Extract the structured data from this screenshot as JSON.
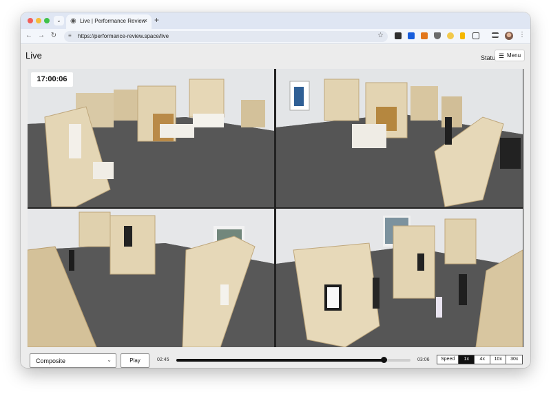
{
  "browser": {
    "tab_title": "Live | Performance Review",
    "tab_favicon": "globe-icon",
    "new_tab_symbol": "+",
    "tab_close_symbol": "×",
    "tab_list_symbol": "⌄",
    "url": "https://performance-review.space/live",
    "nav_icons": [
      "back-arrow-icon",
      "forward-arrow-icon",
      "reload-icon"
    ],
    "extension_icons": [
      "puzzle-square-icon",
      "bitwarden-icon",
      "metamask-fox-icon",
      "shield-icon",
      "emoji-icon",
      "highlighter-icon",
      "extensions-icon",
      "media-queue-icon"
    ],
    "accent": "#dfe6f3"
  },
  "page": {
    "title": "Live",
    "status_label": "Statu",
    "menu_label": "Menu",
    "menu_icon": "hamburger-icon"
  },
  "video": {
    "timestamp": "17:00:06",
    "feeds": [
      "camera-1",
      "camera-2",
      "camera-3",
      "camera-4"
    ]
  },
  "controls": {
    "view_select_value": "Composite",
    "play_label": "Play",
    "time_start": "02:45",
    "time_end": "03:06",
    "progress": 0.885,
    "speed_label": "Speed",
    "speed_options": [
      "1x",
      "4x",
      "10x",
      "30x"
    ],
    "speed_selected": "1x"
  }
}
